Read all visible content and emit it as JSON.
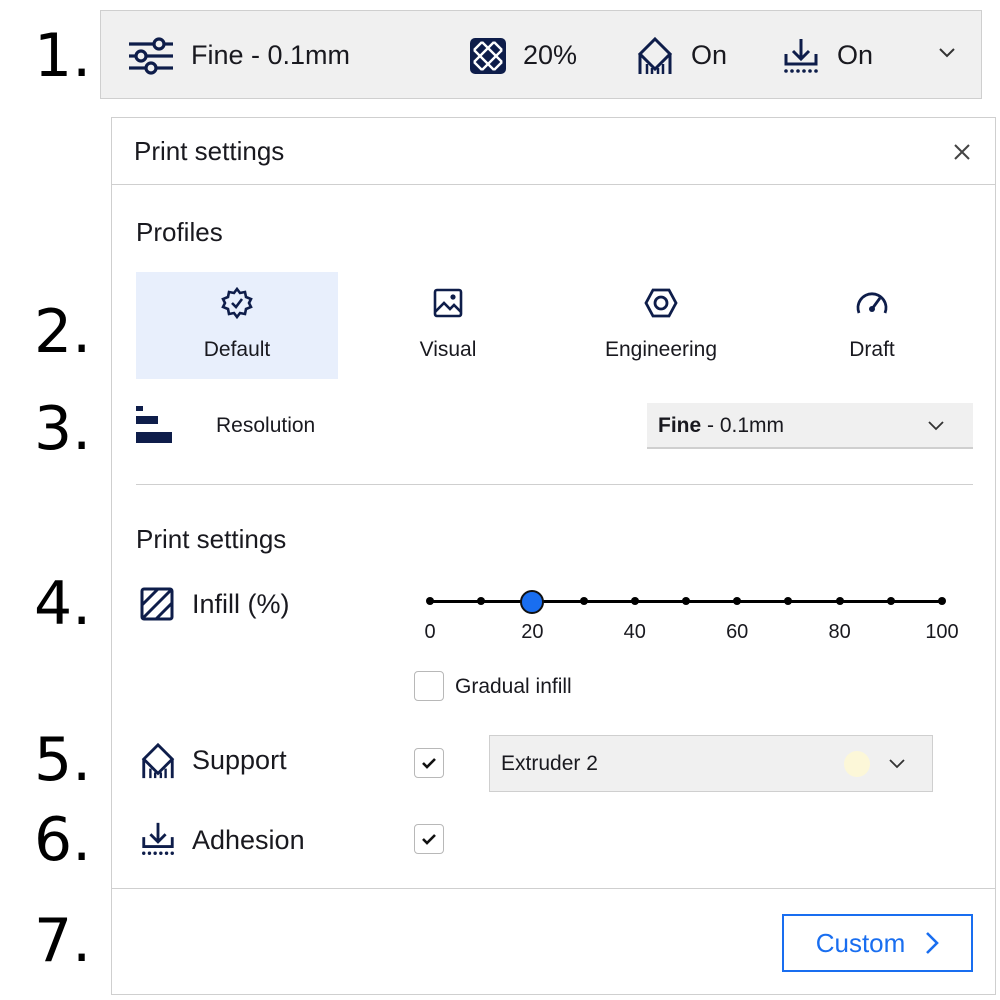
{
  "markers": [
    "1.",
    "2.",
    "3.",
    "4.",
    "5.",
    "6.",
    "7."
  ],
  "topbar": {
    "profile_label": "Fine - 0.1mm",
    "infill_label": "20%",
    "support_label": "On",
    "adhesion_label": "On",
    "icons": [
      "sliders-icon",
      "infill-pattern-icon",
      "support-icon",
      "adhesion-icon",
      "chevron-down-icon"
    ]
  },
  "panel": {
    "title": "Print settings",
    "profiles_title": "Profiles",
    "profiles": [
      {
        "label": "Default",
        "icon": "gear-badge-icon",
        "active": true
      },
      {
        "label": "Visual",
        "icon": "image-icon",
        "active": false
      },
      {
        "label": "Engineering",
        "icon": "hex-nut-icon",
        "active": false
      },
      {
        "label": "Draft",
        "icon": "speedometer-icon",
        "active": false
      }
    ],
    "resolution": {
      "label": "Resolution",
      "value_bold": "Fine",
      "value_rest": " - 0.1mm"
    },
    "settings_title": "Print settings",
    "infill": {
      "label": "Infill (%)",
      "value": 20,
      "min": 0,
      "max": 100,
      "tick_labels": [
        "0",
        "20",
        "40",
        "60",
        "80",
        "100"
      ],
      "gradual_label": "Gradual infill",
      "gradual_checked": false
    },
    "support": {
      "label": "Support",
      "checked": true,
      "extruder": "Extruder 2",
      "extruder_color": "#fcf7d8"
    },
    "adhesion": {
      "label": "Adhesion",
      "checked": true
    },
    "custom_button": "Custom"
  },
  "colors": {
    "accent": "#196ef0",
    "text": "#19191f",
    "icon": "#0e1d4a",
    "active_bg": "#e8effc"
  }
}
